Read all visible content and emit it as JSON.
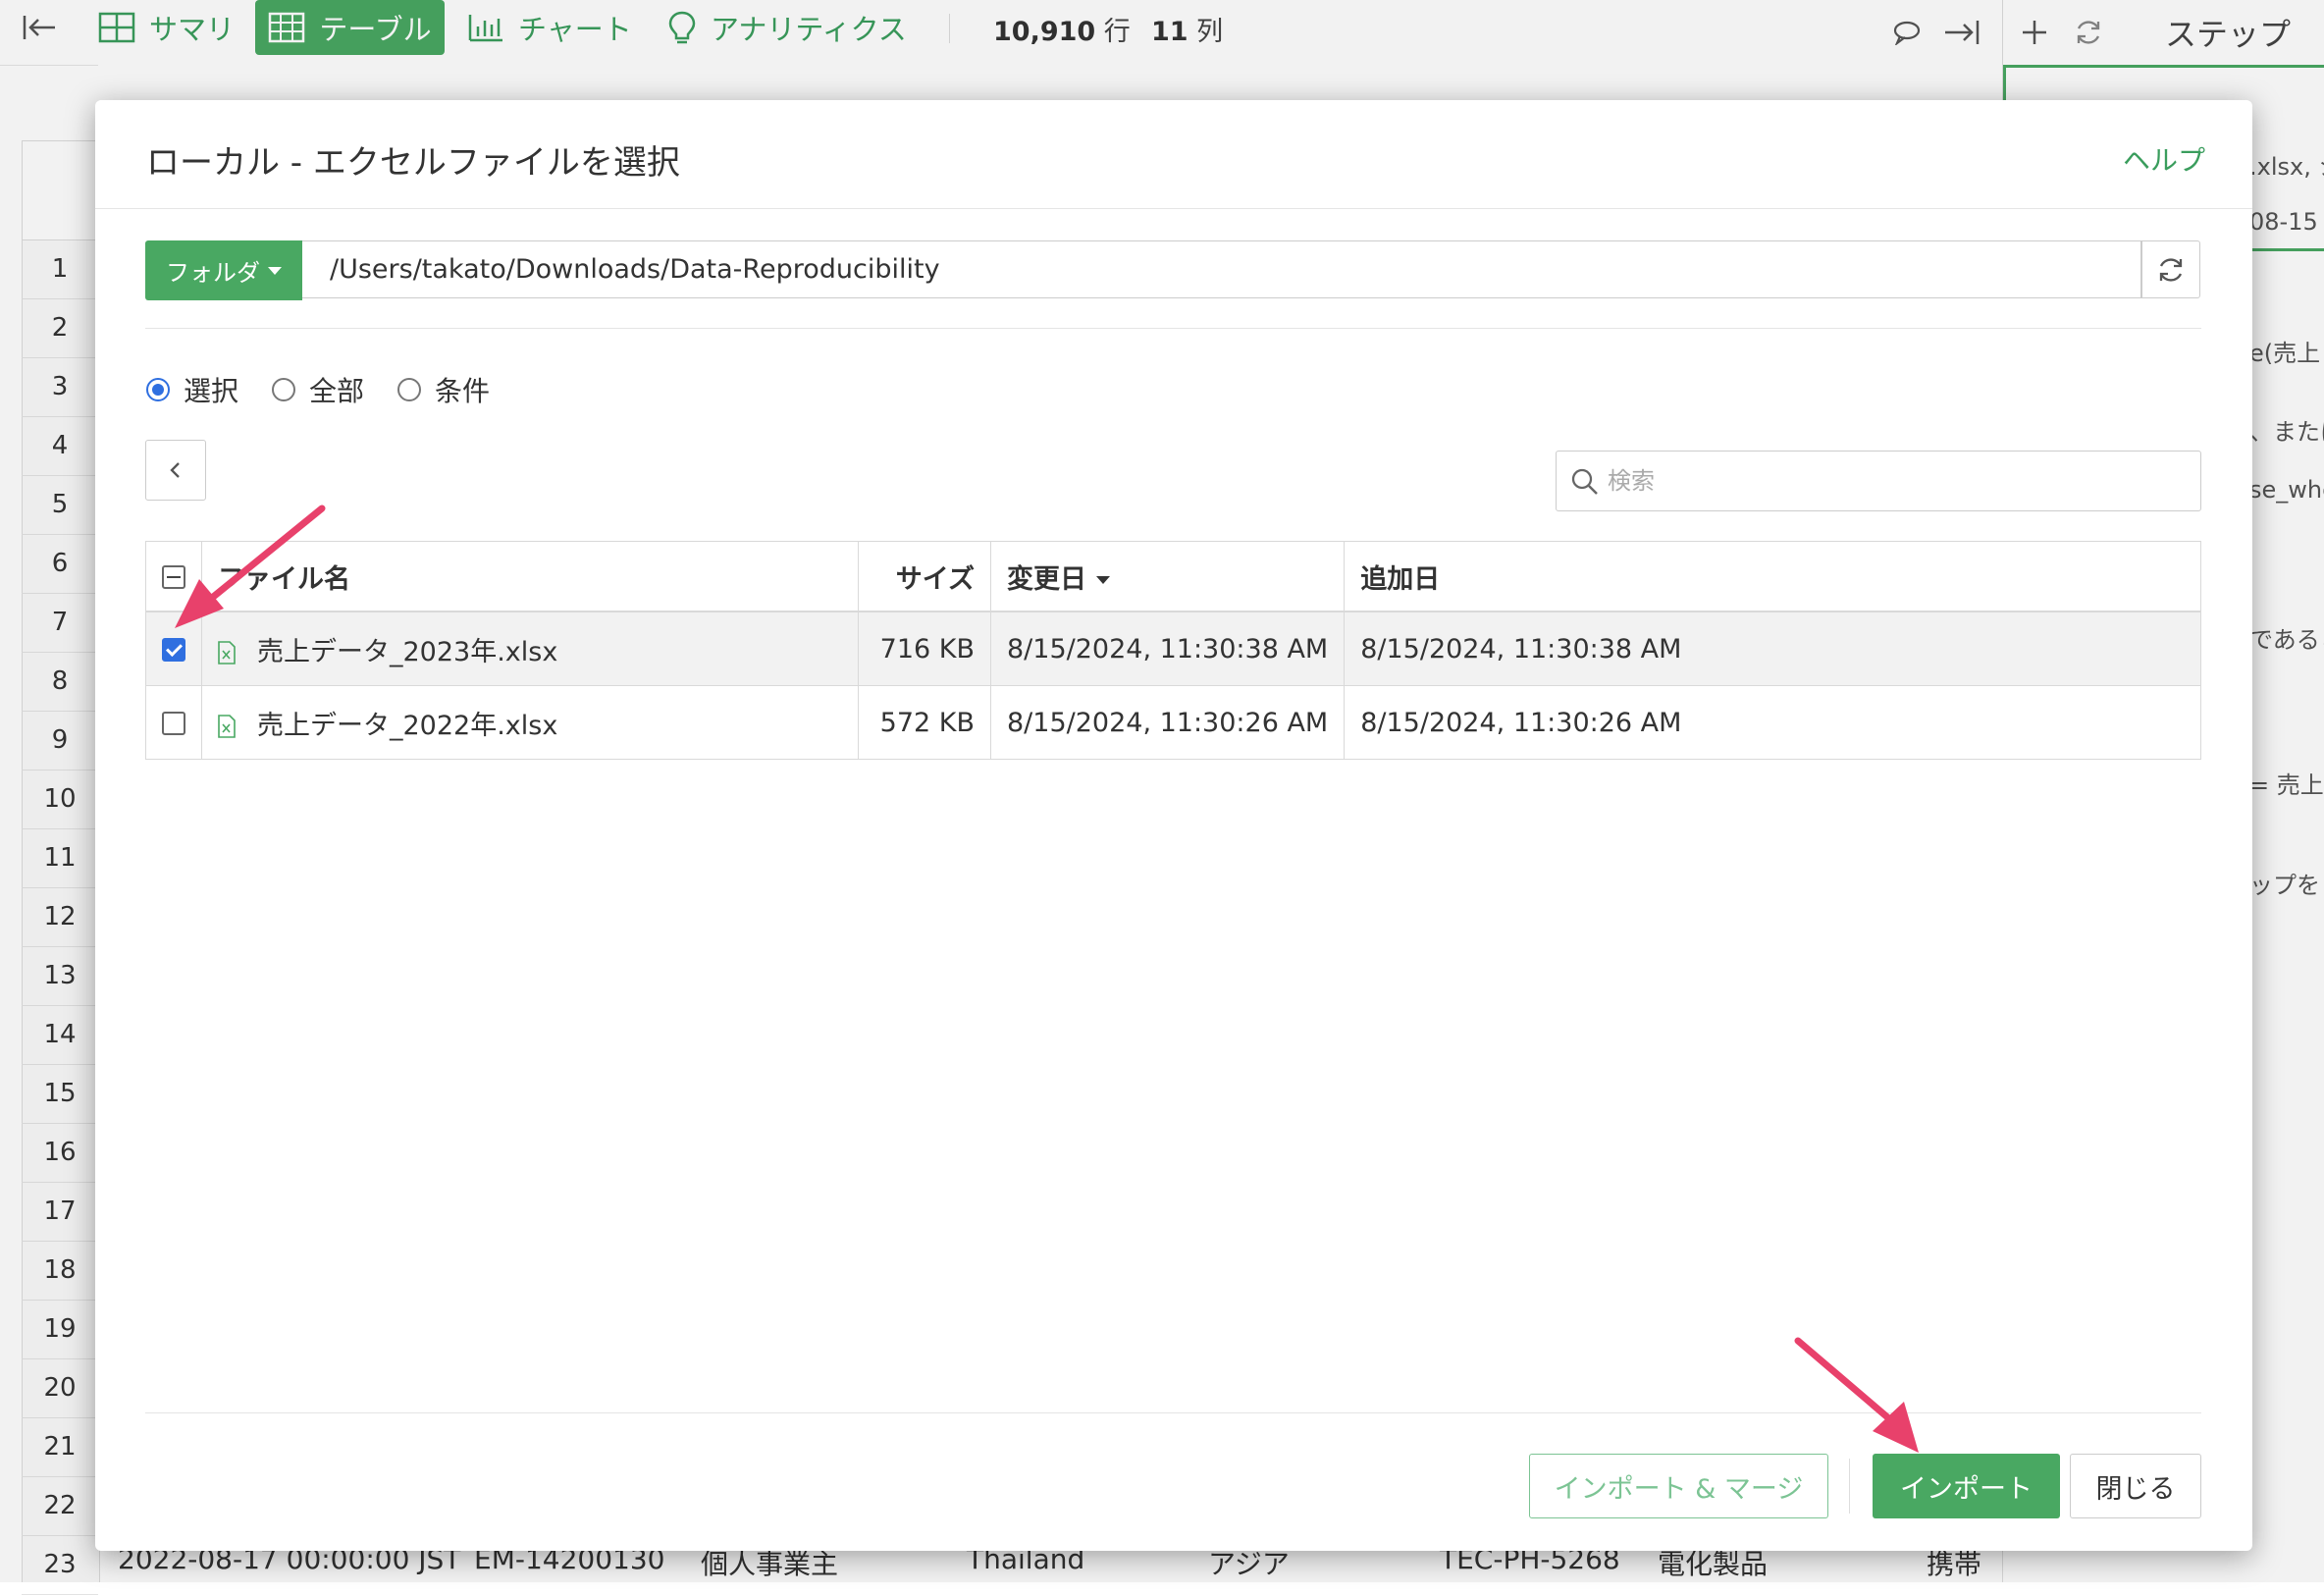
{
  "toolbar": {
    "summary": "サマリ",
    "table": "テーブル",
    "chart": "チャート",
    "analytics": "アナリティクス",
    "rows_count": "10,910",
    "rows_unit": "行",
    "cols_count": "11",
    "cols_unit": "列",
    "steps": "ステップ"
  },
  "background": {
    "row_numbers": [
      "1",
      "2",
      "3",
      "4",
      "5",
      "6",
      "7",
      "8",
      "9",
      "10",
      "11",
      "12",
      "13",
      "14",
      "15",
      "16",
      "17",
      "18",
      "19",
      "20",
      "21",
      "22",
      "23"
    ],
    "bottom_row": [
      "2022-08-17 00:00:00 JST",
      "EM-14200130",
      "個人事業主",
      "Thailand",
      "アジア",
      "TEC-PH-5268",
      "電化製品",
      "携帯"
    ],
    "right_panel_fragments": [
      ".xlsx, シ",
      "08-15 11",
      "e(売上",
      "、または",
      "se_whe",
      "であるこ",
      "= 売上",
      "ップを"
    ]
  },
  "dialog": {
    "title": "ローカル - エクセルファイルを選択",
    "help": "ヘルプ",
    "folder_button": "フォルダ",
    "path": "/Users/takato/Downloads/Data-Reproducibility",
    "radios": [
      {
        "label": "選択",
        "checked": true
      },
      {
        "label": "全部",
        "checked": false
      },
      {
        "label": "条件",
        "checked": false
      }
    ],
    "search": {
      "placeholder": "検索",
      "value": ""
    },
    "table": {
      "headers": {
        "name": "ファイル名",
        "size": "サイズ",
        "modified": "変更日",
        "added": "追加日"
      },
      "rows": [
        {
          "checked": true,
          "name": "売上データ_2023年.xlsx",
          "size": "716 KB",
          "modified": "8/15/2024, 11:30:38 AM",
          "added": "8/15/2024, 11:30:38 AM"
        },
        {
          "checked": false,
          "name": "売上データ_2022年.xlsx",
          "size": "572 KB",
          "modified": "8/15/2024, 11:30:26 AM",
          "added": "8/15/2024, 11:30:26 AM"
        }
      ]
    },
    "buttons": {
      "import_merge": "インポート & マージ",
      "import": "インポート",
      "close": "閉じる"
    }
  },
  "colors": {
    "brand_green": "#49a862",
    "accent_blue": "#2f6fe0",
    "annotation_arrow": "#e8416b"
  }
}
